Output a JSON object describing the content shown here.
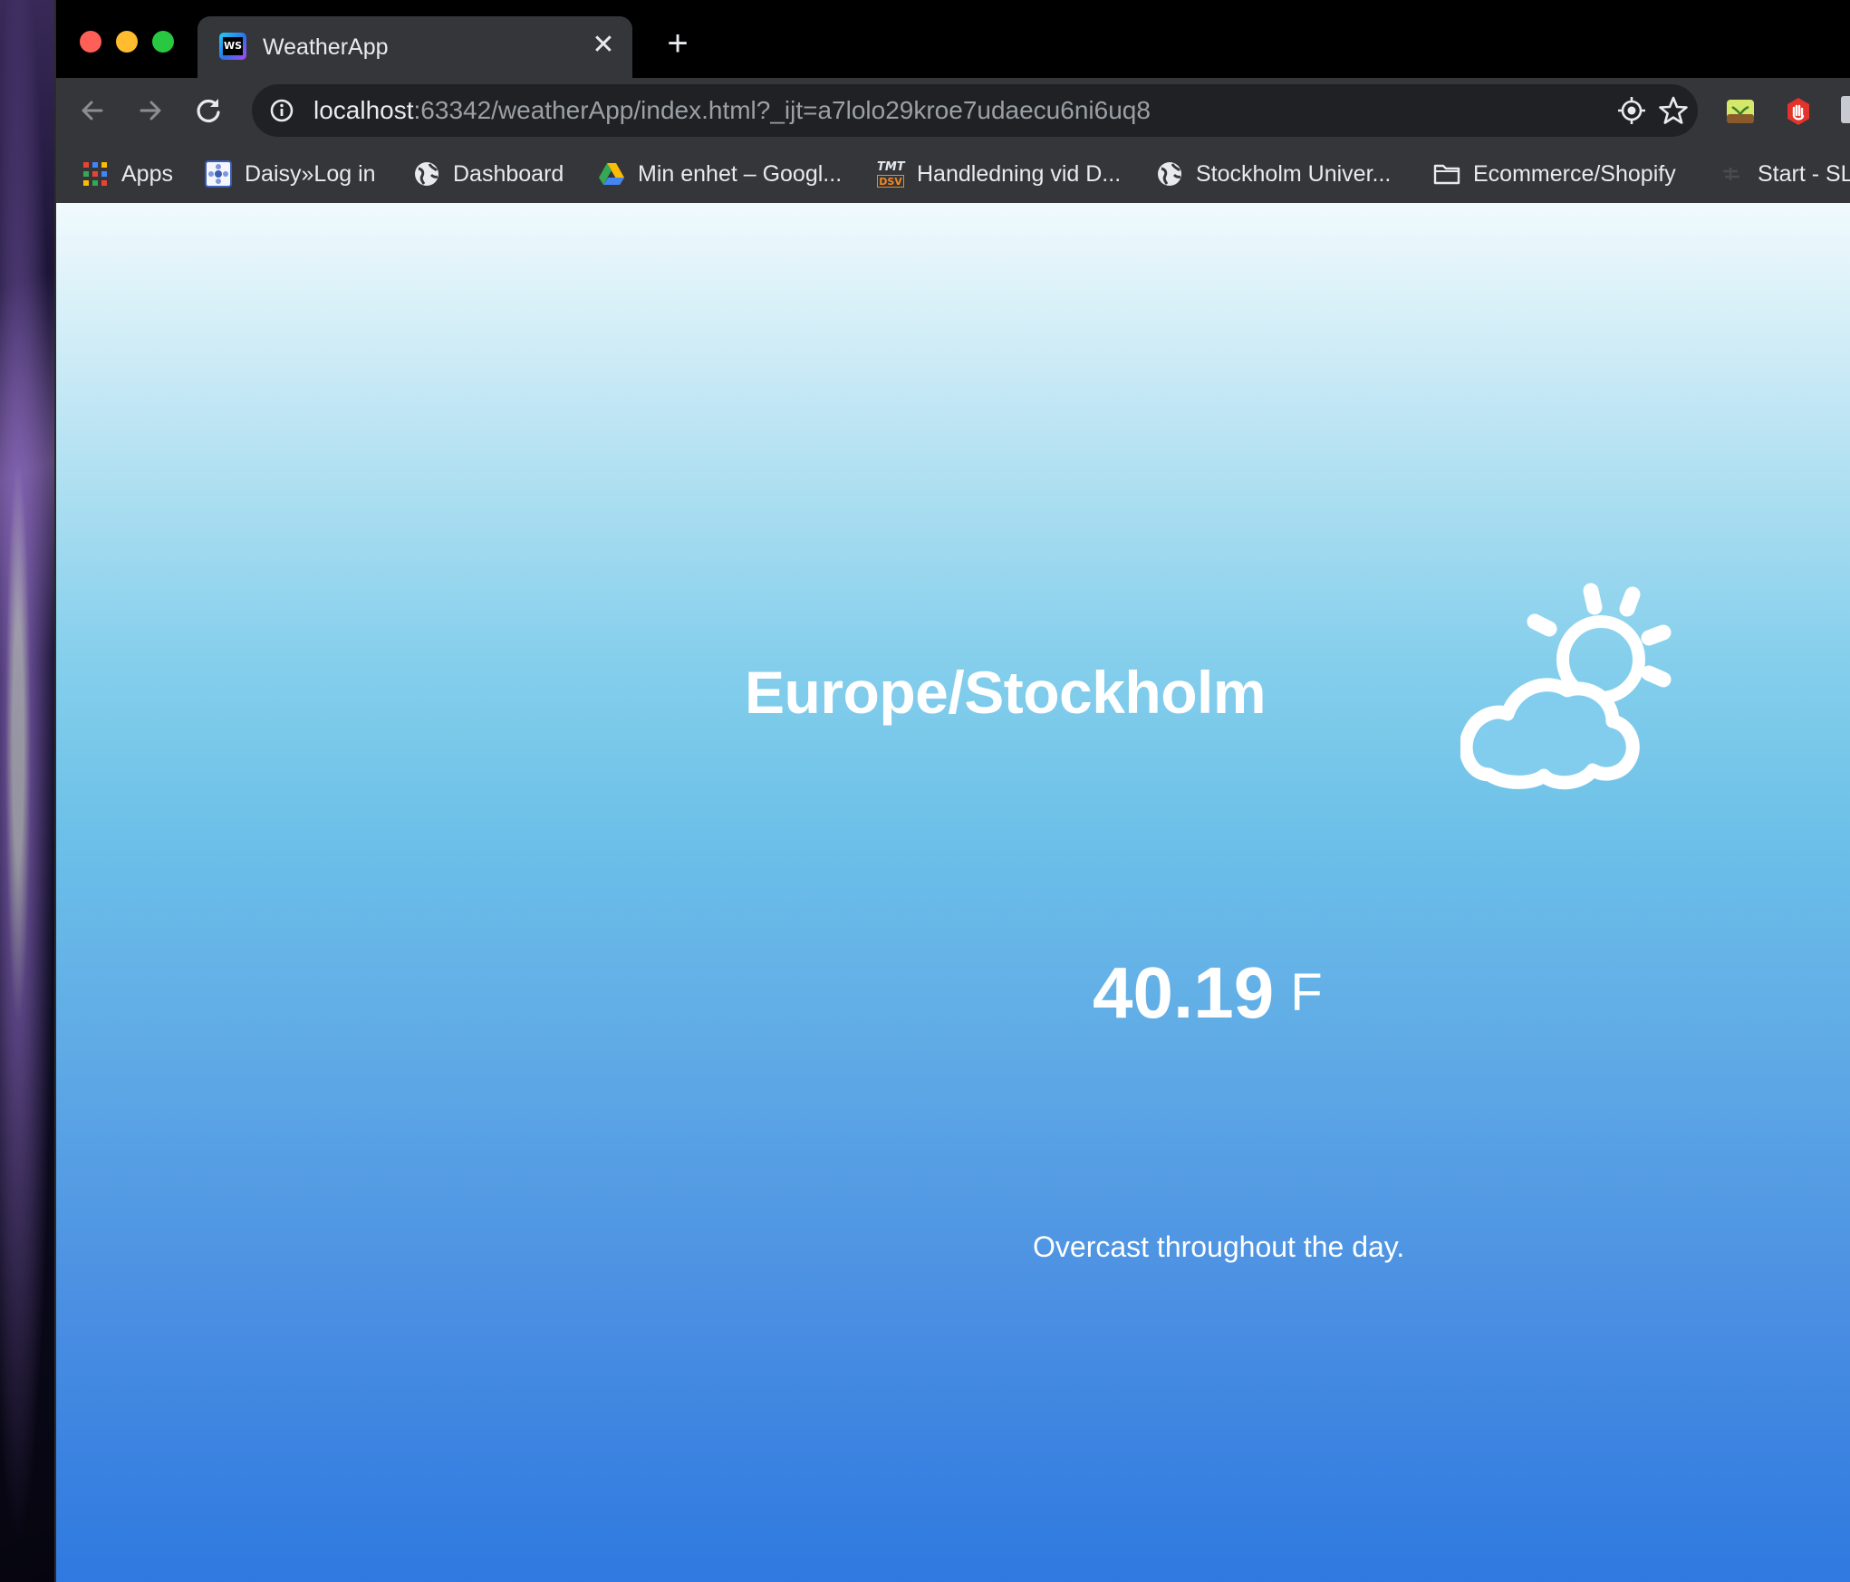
{
  "browser": {
    "tab": {
      "title": "WeatherApp",
      "favicon_text": "WS",
      "close_glyph": "✕"
    },
    "new_tab_glyph": "+",
    "address": {
      "host": "localhost",
      "rest": ":63342/weatherApp/index.html?_ijt=a7lolo29kroe7udaecu6ni6uq8"
    },
    "bookmarks": [
      {
        "label": "Apps",
        "icon": "apps-grid-icon"
      },
      {
        "label": "Daisy»Log in",
        "icon": "daisy-icon"
      },
      {
        "label": "Dashboard",
        "icon": "globe-icon"
      },
      {
        "label": "Min enhet – Googl...",
        "icon": "google-drive-icon"
      },
      {
        "label": "Handledning vid D...",
        "icon": "tmt-dsv-icon"
      },
      {
        "label": "Stockholm Univer...",
        "icon": "globe-icon"
      },
      {
        "label": "Ecommerce/Shopify",
        "icon": "folder-icon"
      },
      {
        "label": "Start - SL",
        "icon": "sl-icon"
      }
    ],
    "tmt_icon_text": {
      "top": "TMT",
      "bottom": "DSV"
    }
  },
  "weather": {
    "location": "Europe/Stockholm",
    "temperature": "40.19",
    "unit": "F",
    "summary": "Overcast throughout the day.",
    "icon": "partly-cloudy-day-icon"
  }
}
